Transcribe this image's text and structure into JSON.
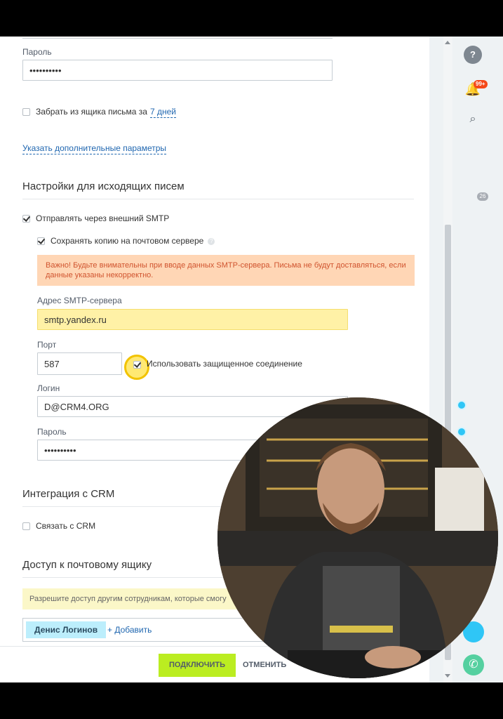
{
  "inbox": {
    "password_label": "Пароль",
    "password_value": "••••••••••",
    "fetch_label": "Забрать из ящика письма за",
    "fetch_period": "7 дней",
    "advanced_link": "Указать дополнительные параметры"
  },
  "outgoing": {
    "section_title": "Настройки для исходящих писем",
    "smtp_checkbox_label": "Отправлять через внешний SMTP",
    "smtp_checked": true,
    "copy_checkbox_label": "Сохранять копию на почтовом сервере",
    "copy_checked": true,
    "warning_text": "Важно! Будьте внимательны при вводе данных SMTP-сервера. Письма не будут доставляться, если данные указаны некорректно.",
    "server_label": "Адрес SMTP-сервера",
    "server_value": "smtp.yandex.ru",
    "port_label": "Порт",
    "port_value": "587",
    "secure_label": "Использовать защищенное соединение",
    "secure_checked": true,
    "login_label": "Логин",
    "login_value": "D@CRM4.ORG",
    "password_label": "Пароль",
    "password_value": "••••••••••"
  },
  "crm": {
    "section_title": "Интеграция с CRM",
    "link_checkbox_label": "Связать с CRM",
    "link_checked": false
  },
  "access": {
    "section_title": "Доступ к почтовому ящику",
    "hint_text": "Разрешите доступ другим сотрудникам, которые смогу",
    "users": [
      "Денис Логинов"
    ],
    "add_label": "+ Добавить"
  },
  "footer": {
    "connect_label": "ПОДКЛЮЧИТЬ",
    "cancel_label": "ОТМЕНИТЬ"
  },
  "rightbar": {
    "help_icon": "?",
    "notifications_badge": "99+",
    "counter_badge": "26"
  },
  "colors": {
    "accent_green": "#bbed21",
    "link_blue": "#2067b0",
    "warning_bg": "#ffd6b5",
    "warning_text": "#d0542f",
    "highlight_yellow": "#fff1a6"
  }
}
